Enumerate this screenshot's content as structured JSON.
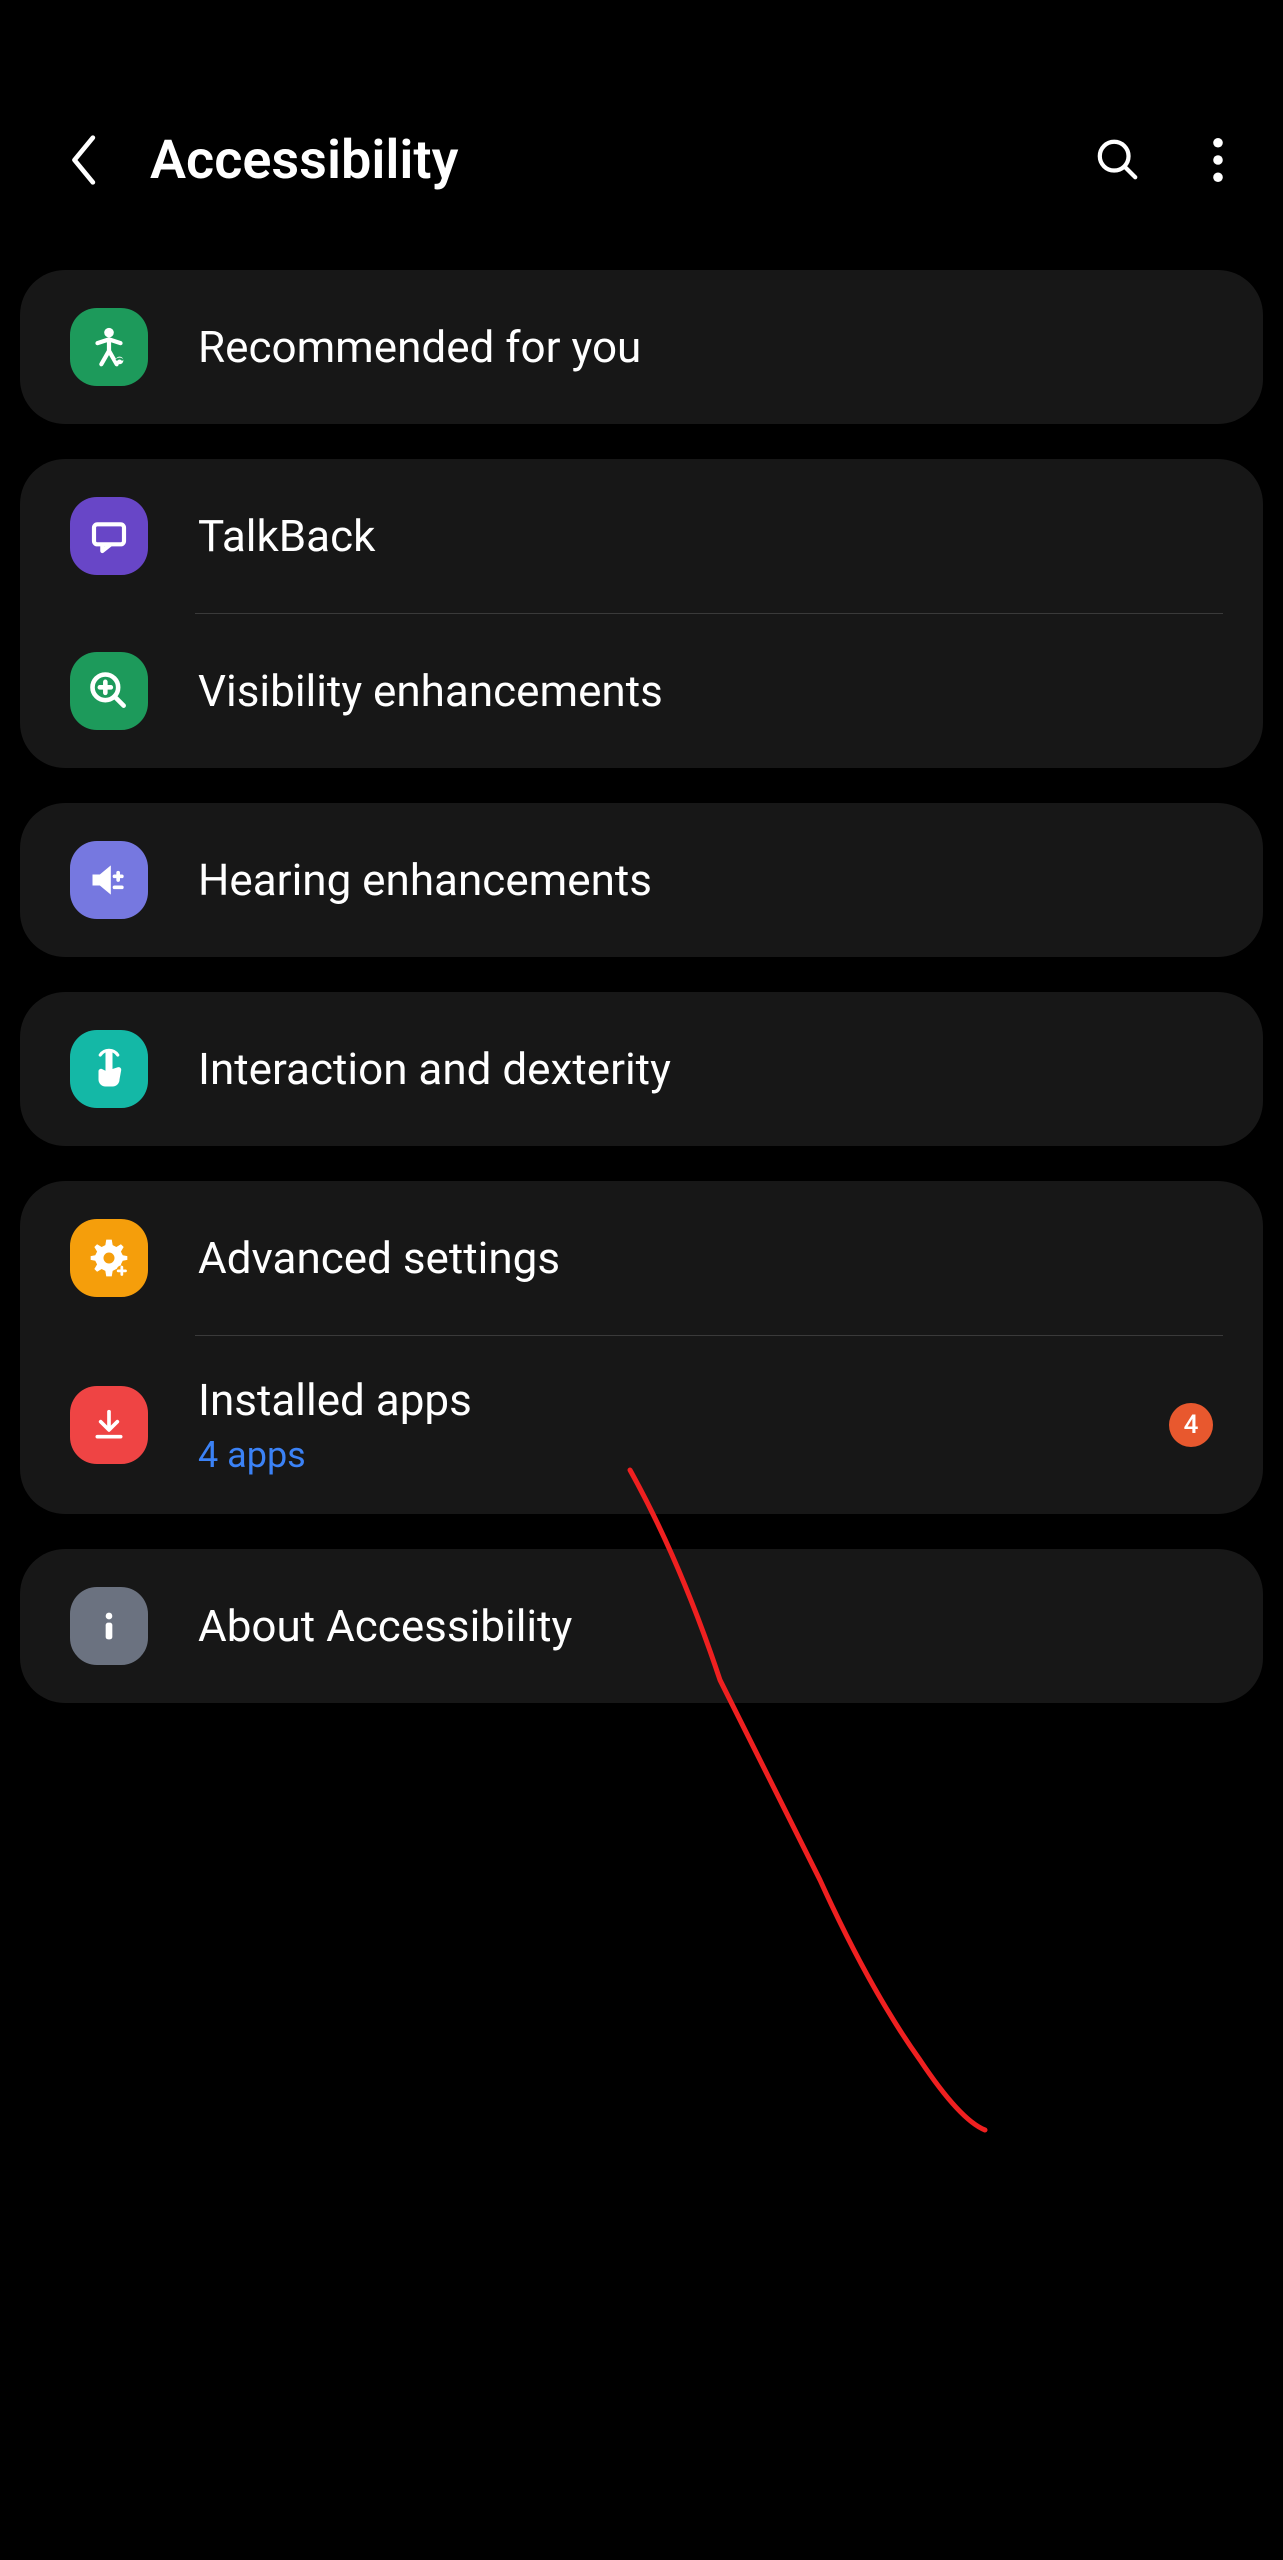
{
  "header": {
    "title": "Accessibility"
  },
  "sections": {
    "recommended": {
      "label": "Recommended for you"
    },
    "talkback": {
      "label": "TalkBack"
    },
    "visibility": {
      "label": "Visibility enhancements"
    },
    "hearing": {
      "label": "Hearing enhancements"
    },
    "interaction": {
      "label": "Interaction and dexterity"
    },
    "advanced": {
      "label": "Advanced settings"
    },
    "installed": {
      "label": "Installed apps",
      "sublabel": "4 apps",
      "badge": "4"
    },
    "about": {
      "label": "About Accessibility"
    }
  }
}
